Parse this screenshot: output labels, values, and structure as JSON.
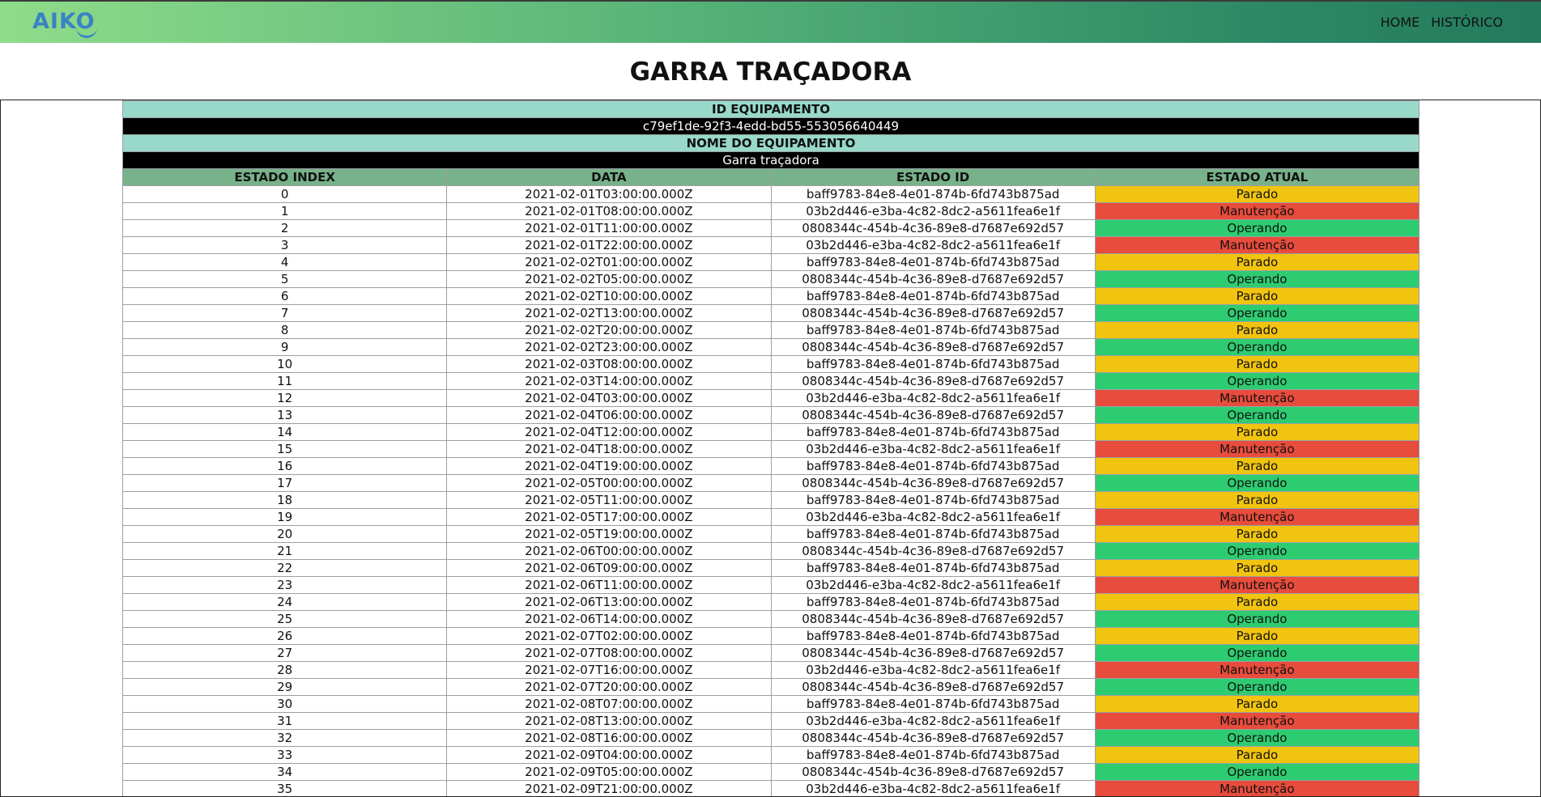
{
  "nav": {
    "logo": "AIKO",
    "links": [
      "HOME",
      "HISTÓRICO"
    ]
  },
  "page_title": "GARRA TRAÇADORA",
  "equipment": {
    "id_label": "ID EQUIPAMENTO",
    "id_value": "c79ef1de-92f3-4edd-bd55-553056640449",
    "name_label": "NOME DO EQUIPAMENTO",
    "name_value": "Garra traçadora"
  },
  "table": {
    "columns": [
      "ESTADO INDEX",
      "DATA",
      "ESTADO ID",
      "ESTADO ATUAL"
    ],
    "status_colors": {
      "Parado": "#f1c40f",
      "Manutenção": "#e74c3c",
      "Operando": "#2ecc71"
    },
    "rows": [
      [
        "0",
        "2021-02-01T03:00:00.000Z",
        "baff9783-84e8-4e01-874b-6fd743b875ad",
        "Parado"
      ],
      [
        "1",
        "2021-02-01T08:00:00.000Z",
        "03b2d446-e3ba-4c82-8dc2-a5611fea6e1f",
        "Manutenção"
      ],
      [
        "2",
        "2021-02-01T11:00:00.000Z",
        "0808344c-454b-4c36-89e8-d7687e692d57",
        "Operando"
      ],
      [
        "3",
        "2021-02-01T22:00:00.000Z",
        "03b2d446-e3ba-4c82-8dc2-a5611fea6e1f",
        "Manutenção"
      ],
      [
        "4",
        "2021-02-02T01:00:00.000Z",
        "baff9783-84e8-4e01-874b-6fd743b875ad",
        "Parado"
      ],
      [
        "5",
        "2021-02-02T05:00:00.000Z",
        "0808344c-454b-4c36-89e8-d7687e692d57",
        "Operando"
      ],
      [
        "6",
        "2021-02-02T10:00:00.000Z",
        "baff9783-84e8-4e01-874b-6fd743b875ad",
        "Parado"
      ],
      [
        "7",
        "2021-02-02T13:00:00.000Z",
        "0808344c-454b-4c36-89e8-d7687e692d57",
        "Operando"
      ],
      [
        "8",
        "2021-02-02T20:00:00.000Z",
        "baff9783-84e8-4e01-874b-6fd743b875ad",
        "Parado"
      ],
      [
        "9",
        "2021-02-02T23:00:00.000Z",
        "0808344c-454b-4c36-89e8-d7687e692d57",
        "Operando"
      ],
      [
        "10",
        "2021-02-03T08:00:00.000Z",
        "baff9783-84e8-4e01-874b-6fd743b875ad",
        "Parado"
      ],
      [
        "11",
        "2021-02-03T14:00:00.000Z",
        "0808344c-454b-4c36-89e8-d7687e692d57",
        "Operando"
      ],
      [
        "12",
        "2021-02-04T03:00:00.000Z",
        "03b2d446-e3ba-4c82-8dc2-a5611fea6e1f",
        "Manutenção"
      ],
      [
        "13",
        "2021-02-04T06:00:00.000Z",
        "0808344c-454b-4c36-89e8-d7687e692d57",
        "Operando"
      ],
      [
        "14",
        "2021-02-04T12:00:00.000Z",
        "baff9783-84e8-4e01-874b-6fd743b875ad",
        "Parado"
      ],
      [
        "15",
        "2021-02-04T18:00:00.000Z",
        "03b2d446-e3ba-4c82-8dc2-a5611fea6e1f",
        "Manutenção"
      ],
      [
        "16",
        "2021-02-04T19:00:00.000Z",
        "baff9783-84e8-4e01-874b-6fd743b875ad",
        "Parado"
      ],
      [
        "17",
        "2021-02-05T00:00:00.000Z",
        "0808344c-454b-4c36-89e8-d7687e692d57",
        "Operando"
      ],
      [
        "18",
        "2021-02-05T11:00:00.000Z",
        "baff9783-84e8-4e01-874b-6fd743b875ad",
        "Parado"
      ],
      [
        "19",
        "2021-02-05T17:00:00.000Z",
        "03b2d446-e3ba-4c82-8dc2-a5611fea6e1f",
        "Manutenção"
      ],
      [
        "20",
        "2021-02-05T19:00:00.000Z",
        "baff9783-84e8-4e01-874b-6fd743b875ad",
        "Parado"
      ],
      [
        "21",
        "2021-02-06T00:00:00.000Z",
        "0808344c-454b-4c36-89e8-d7687e692d57",
        "Operando"
      ],
      [
        "22",
        "2021-02-06T09:00:00.000Z",
        "baff9783-84e8-4e01-874b-6fd743b875ad",
        "Parado"
      ],
      [
        "23",
        "2021-02-06T11:00:00.000Z",
        "03b2d446-e3ba-4c82-8dc2-a5611fea6e1f",
        "Manutenção"
      ],
      [
        "24",
        "2021-02-06T13:00:00.000Z",
        "baff9783-84e8-4e01-874b-6fd743b875ad",
        "Parado"
      ],
      [
        "25",
        "2021-02-06T14:00:00.000Z",
        "0808344c-454b-4c36-89e8-d7687e692d57",
        "Operando"
      ],
      [
        "26",
        "2021-02-07T02:00:00.000Z",
        "baff9783-84e8-4e01-874b-6fd743b875ad",
        "Parado"
      ],
      [
        "27",
        "2021-02-07T08:00:00.000Z",
        "0808344c-454b-4c36-89e8-d7687e692d57",
        "Operando"
      ],
      [
        "28",
        "2021-02-07T16:00:00.000Z",
        "03b2d446-e3ba-4c82-8dc2-a5611fea6e1f",
        "Manutenção"
      ],
      [
        "29",
        "2021-02-07T20:00:00.000Z",
        "0808344c-454b-4c36-89e8-d7687e692d57",
        "Operando"
      ],
      [
        "30",
        "2021-02-08T07:00:00.000Z",
        "baff9783-84e8-4e01-874b-6fd743b875ad",
        "Parado"
      ],
      [
        "31",
        "2021-02-08T13:00:00.000Z",
        "03b2d446-e3ba-4c82-8dc2-a5611fea6e1f",
        "Manutenção"
      ],
      [
        "32",
        "2021-02-08T16:00:00.000Z",
        "0808344c-454b-4c36-89e8-d7687e692d57",
        "Operando"
      ],
      [
        "33",
        "2021-02-09T04:00:00.000Z",
        "baff9783-84e8-4e01-874b-6fd743b875ad",
        "Parado"
      ],
      [
        "34",
        "2021-02-09T05:00:00.000Z",
        "0808344c-454b-4c36-89e8-d7687e692d57",
        "Operando"
      ],
      [
        "35",
        "2021-02-09T21:00:00.000Z",
        "03b2d446-e3ba-4c82-8dc2-a5611fea6e1f",
        "Manutenção"
      ]
    ]
  }
}
